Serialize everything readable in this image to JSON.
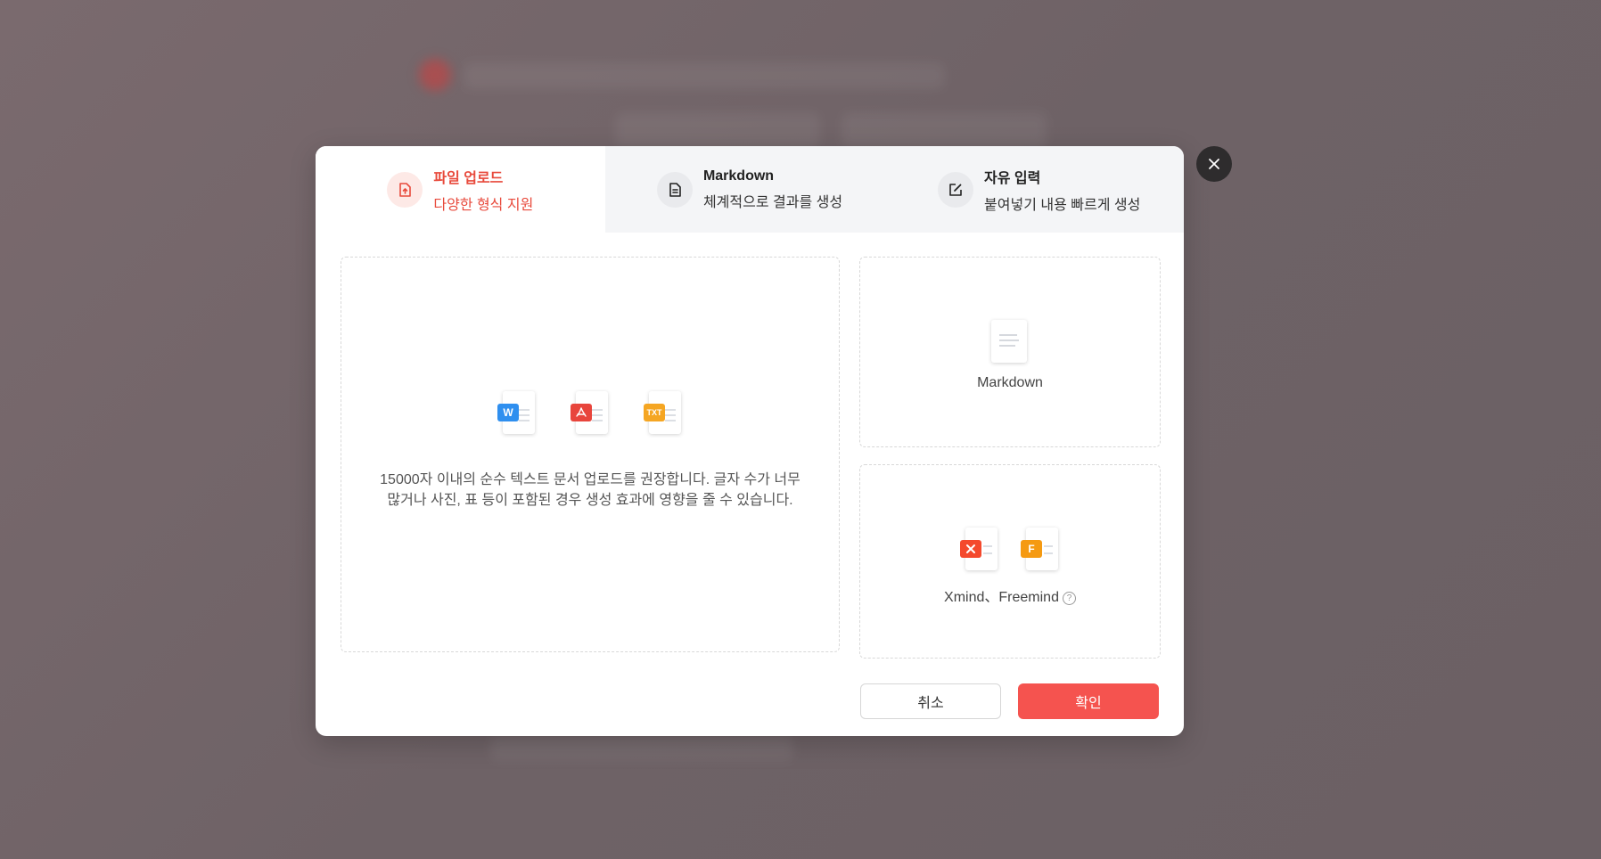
{
  "tabs": [
    {
      "title": "파일 업로드",
      "subtitle": "다양한 형식 지원",
      "icon": "file-upload-icon",
      "active": true
    },
    {
      "title": "Markdown",
      "subtitle": "체계적으로 결과를 생성",
      "icon": "document-icon",
      "active": false
    },
    {
      "title": "자유 입력",
      "subtitle": "붙여넣기 내용 빠르게 생성",
      "icon": "edit-icon",
      "active": false
    }
  ],
  "upload": {
    "file_types": [
      {
        "label": "W",
        "color": "#2f8fef"
      },
      {
        "label": "",
        "color": "#e8453c"
      },
      {
        "label": "TXT",
        "color": "#f5a623"
      }
    ],
    "description": "15000자 이내의 순수 텍스트 문서 업로드를 권장합니다. 글자 수가 너무 많거나 사진, 표 등이 포함된 경우 생성 효과에 영향을 줄 수 있습니다."
  },
  "cards": {
    "markdown_label": "Markdown",
    "mindmap_label": "Xmind、Freemind",
    "help_icon": "?"
  },
  "buttons": {
    "cancel": "취소",
    "ok": "확인"
  },
  "colors": {
    "accent": "#f5534f",
    "active_tab_text": "#e84a3c"
  }
}
